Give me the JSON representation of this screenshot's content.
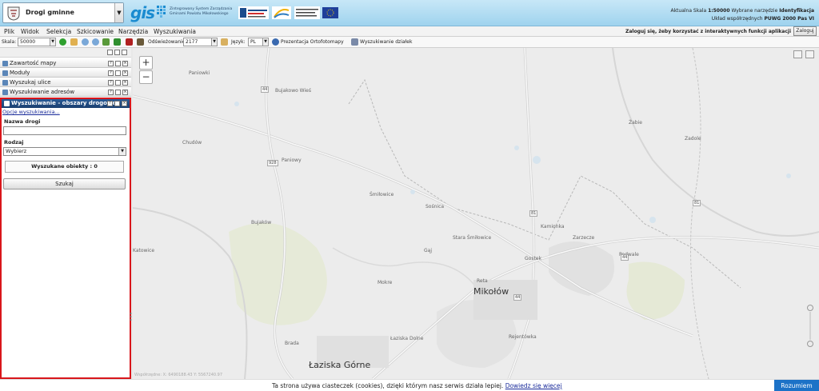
{
  "header": {
    "app_title": "Drogi gminne",
    "logo_text": "gis",
    "logo_subtitle_1": "Zintegrowany System Zarządzania",
    "logo_subtitle_2": "Gminami Powiatu Mikołowskiego",
    "status_line_1_label": "Aktualna Skala",
    "status_line_1_scale": "1:50000",
    "status_line_1_tool_label": "Wybrane narzędzie",
    "status_line_1_tool": "Identyfikacja",
    "status_line_2_label": "Układ współrzędnych",
    "status_line_2_value": "PUWG 2000 Pas VI"
  },
  "menu": {
    "items": [
      "Plik",
      "Widok",
      "Selekcja",
      "Szkicowanie",
      "Narzędzia",
      "Wyszukiwania"
    ],
    "login_message": "Zaloguj się, żeby korzystać z interaktywnych funkcji aplikacji",
    "login_button": "Zaloguj"
  },
  "toolbar": {
    "scale_label": "Skala:",
    "scale_value": "50000",
    "refresh_label": "Odświeżowanie:",
    "refresh_value": "2177",
    "language_label": "Język:",
    "language_value": "PL",
    "ortho_label": "Prezentacja Ortofotomapy",
    "parcel_label": "Wyszukiwanie działek"
  },
  "left_panel": {
    "accordion": [
      "Zawartość mapy",
      "Moduły",
      "Wyszukaj ulice",
      "Wyszukiwanie adresów"
    ],
    "search": {
      "title": "Wyszukiwanie - obszary drogowe",
      "link": "Opcje wyszukiwania...",
      "road_name_label": "Nazwa drogi",
      "road_name_value": "",
      "type_label": "Rodzaj",
      "type_value": "Wybierz",
      "found_label": "Wyszukane obiekty : 0",
      "search_button": "Szukaj"
    }
  },
  "map": {
    "zoom_in": "+",
    "zoom_out": "−",
    "labels": [
      "Paniowki",
      "Bujakowo Wieś",
      "Chudów",
      "Paniowy",
      "Śmiłowice",
      "Bujaków",
      "Sośnica",
      "Gąj",
      "Stara Śmiłowice",
      "Mokre",
      "Reta",
      "Kamionka",
      "Gostek",
      "Podwale",
      "Zarzecze",
      "Łaziska Dolne",
      "Rejentówka",
      "Brada",
      "Katowice",
      "Żabie",
      "Zadole"
    ],
    "towns": [
      "Mikołów",
      "Łaziska Górne"
    ],
    "road_numbers": [
      "44",
      "928",
      "81",
      "44",
      "81",
      "44"
    ],
    "coords": "Współrzędne: X: 6490188.43 Y: 5567240.97"
  },
  "cookie": {
    "text": "Ta strona używa ciasteczek (cookies), dzięki którym nasz serwis działa lepiej.",
    "link": "Dowiedz się więcej",
    "accept": "Rozumiem"
  }
}
